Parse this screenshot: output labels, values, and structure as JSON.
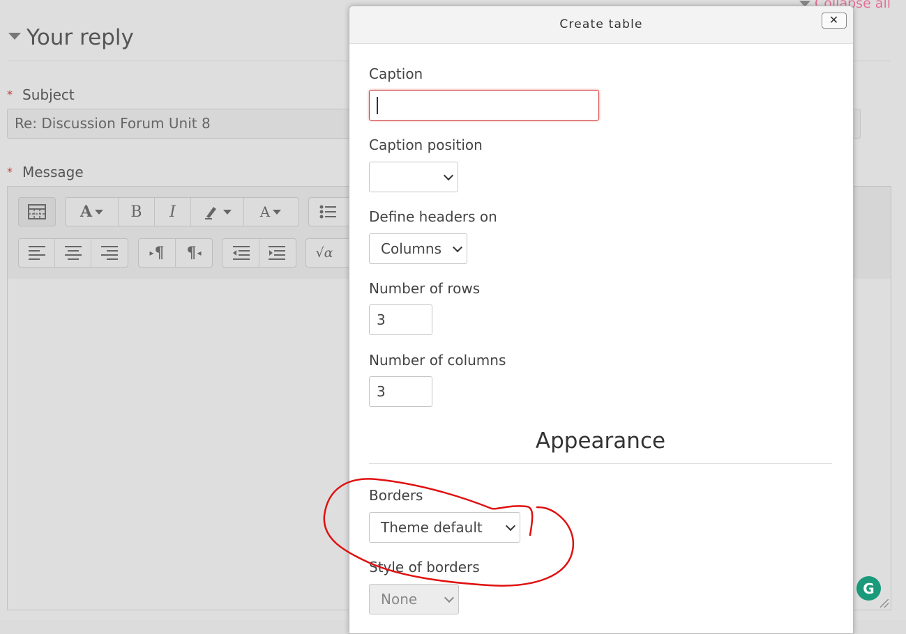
{
  "page": {
    "collapse_all": "Collapse all",
    "section_title": "Your reply",
    "required_mark": "*",
    "subject_label": "Subject",
    "subject_value": "Re: Discussion Forum Unit 8",
    "message_label": "Message"
  },
  "toolbar": {
    "row1": [
      {
        "icon": "table-icon"
      },
      {
        "icon": "font-style-icon",
        "text": "A"
      },
      {
        "icon": "bold-icon",
        "text": "B"
      },
      {
        "icon": "italic-icon",
        "text": "I"
      },
      {
        "icon": "highlight-icon"
      },
      {
        "icon": "font-color-icon",
        "text": "A"
      },
      {
        "icon": "bullet-list-icon"
      }
    ],
    "row2": [
      {
        "icon": "align-left-icon"
      },
      {
        "icon": "align-center-icon"
      },
      {
        "icon": "align-right-icon"
      },
      {
        "icon": "ltr-icon",
        "text": "¶"
      },
      {
        "icon": "rtl-icon",
        "text": "¶"
      },
      {
        "icon": "outdent-icon"
      },
      {
        "icon": "indent-icon"
      },
      {
        "icon": "equation-icon",
        "text": "√α"
      }
    ]
  },
  "grammarly": {
    "letter": "G",
    "color": "#1a9a7a"
  },
  "dialog": {
    "title": "Create table",
    "close_symbol": "✕",
    "caption_label": "Caption",
    "caption_value": "",
    "caption_position_label": "Caption position",
    "caption_position_value": "",
    "headers_label": "Define headers on",
    "headers_value": "Columns",
    "rows_label": "Number of rows",
    "rows_value": "3",
    "columns_label": "Number of columns",
    "columns_value": "3",
    "appearance_heading": "Appearance",
    "borders_label": "Borders",
    "borders_value": "Theme default",
    "border_style_label": "Style of borders",
    "border_style_value": "None"
  },
  "colors": {
    "error_border": "#d24040",
    "annotation": "#e01010",
    "link": "#e56f95"
  }
}
